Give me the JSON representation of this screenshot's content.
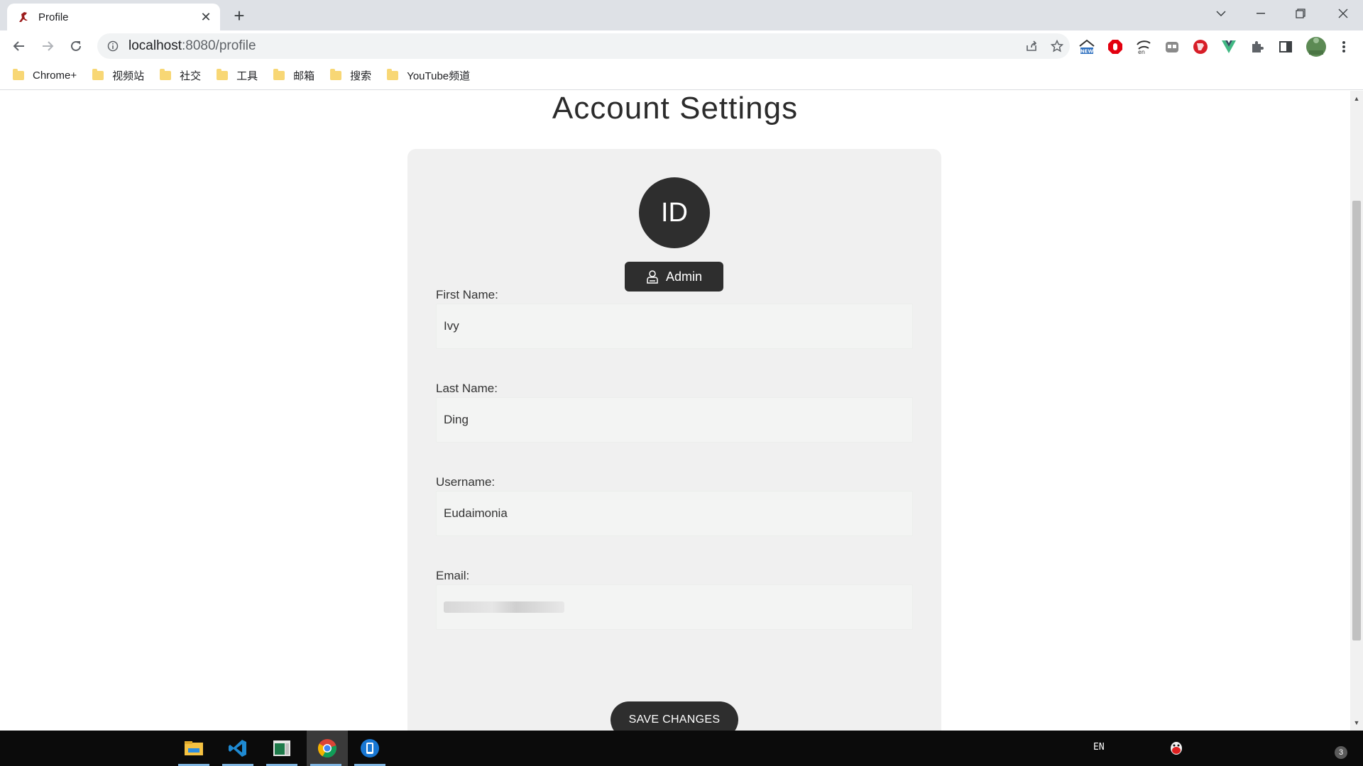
{
  "browser": {
    "tab_title": "Profile",
    "url_host": "localhost",
    "url_rest": ":8080/profile",
    "bookmarks": [
      "Chrome+",
      "视频站",
      "社交",
      "工具",
      "邮箱",
      "搜索",
      "YouTube频道"
    ]
  },
  "page": {
    "title": "Account Settings",
    "avatar_initials": "ID",
    "role_label": "Admin",
    "fields": {
      "first_name": {
        "label": "First Name:",
        "value": "Ivy"
      },
      "last_name": {
        "label": "Last Name:",
        "value": "Ding"
      },
      "username": {
        "label": "Username:",
        "value": "Eudaimonia"
      },
      "email": {
        "label": "Email:",
        "value": ""
      }
    },
    "save_label": "SAVE CHANGES"
  },
  "taskbar": {
    "language": "EN",
    "notification_count": "3"
  },
  "colors": {
    "accent_dark": "#2e2e2e",
    "card_bg": "#f0f0f0",
    "input_bg": "#f3f4f3"
  }
}
